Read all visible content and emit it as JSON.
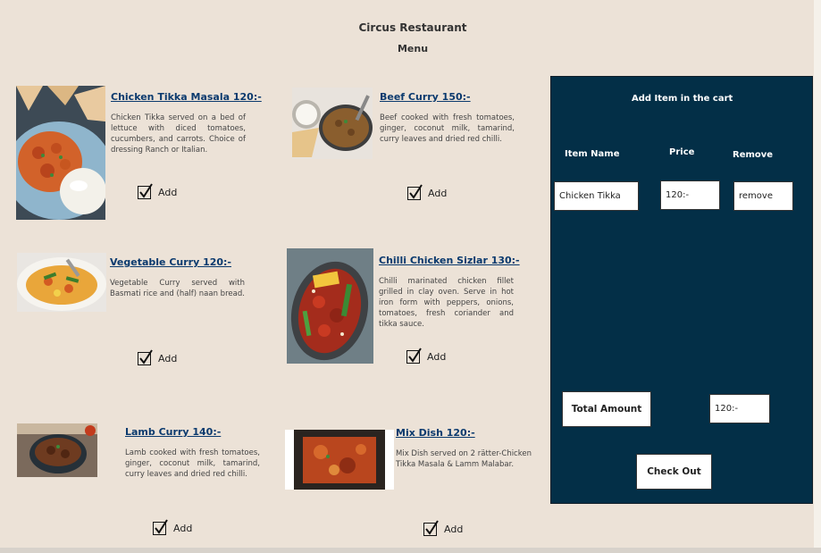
{
  "header": {
    "title": "Circus Restaurant",
    "menu_label": "Menu"
  },
  "menu_items": [
    {
      "title": "Chicken Tikka Masala 120:-",
      "description": "Chicken Tikka served on a bed of lettuce with diced tomatoes, cucumbers, and carrots. Choice of dressing Ranch or Italian.",
      "add_label": "Add",
      "checked": true
    },
    {
      "title": "Beef Curry 150:-",
      "description": "Beef cooked with fresh tomatoes, ginger, coconut milk, tamarind, curry leaves and dried red chilli.",
      "add_label": "Add",
      "checked": true
    },
    {
      "title": "Vegetable Curry 120:-",
      "description": "Vegetable Curry served with Basmati rice and (half) naan bread.",
      "add_label": "Add",
      "checked": true
    },
    {
      "title": "Chilli Chicken Sizlar 130:-",
      "description": "Chilli marinated chicken fillet grilled in clay oven. Serve in hot iron form with peppers, onions, tomatoes, fresh coriander and tikka sauce.",
      "add_label": "Add",
      "checked": true
    },
    {
      "title": "Lamb Curry 140:-",
      "description": "Lamb cooked with fresh tomatoes, ginger, coconut milk, tamarind, curry leaves and dried red chilli.",
      "add_label": "Add",
      "checked": true
    },
    {
      "title": "Mix Dish 120:-",
      "description": "Mix Dish served on 2 rätter-Chicken Tikka Masala & Lamm Malabar.",
      "add_label": "Add",
      "checked": true
    }
  ],
  "cart": {
    "heading": "Add  Item in the cart",
    "col_item_name": "Item Name",
    "col_price": "Price",
    "col_remove": "Remove",
    "row": {
      "item_name": "Chicken Tikka",
      "price": "120:-",
      "remove": "remove"
    },
    "total_label": "Total Amount",
    "total_value": "120:-",
    "checkout_label": "Check Out"
  },
  "colors": {
    "background": "#ece2d7",
    "cart_panel": "#032f47",
    "title_link": "#0b3a6e"
  }
}
